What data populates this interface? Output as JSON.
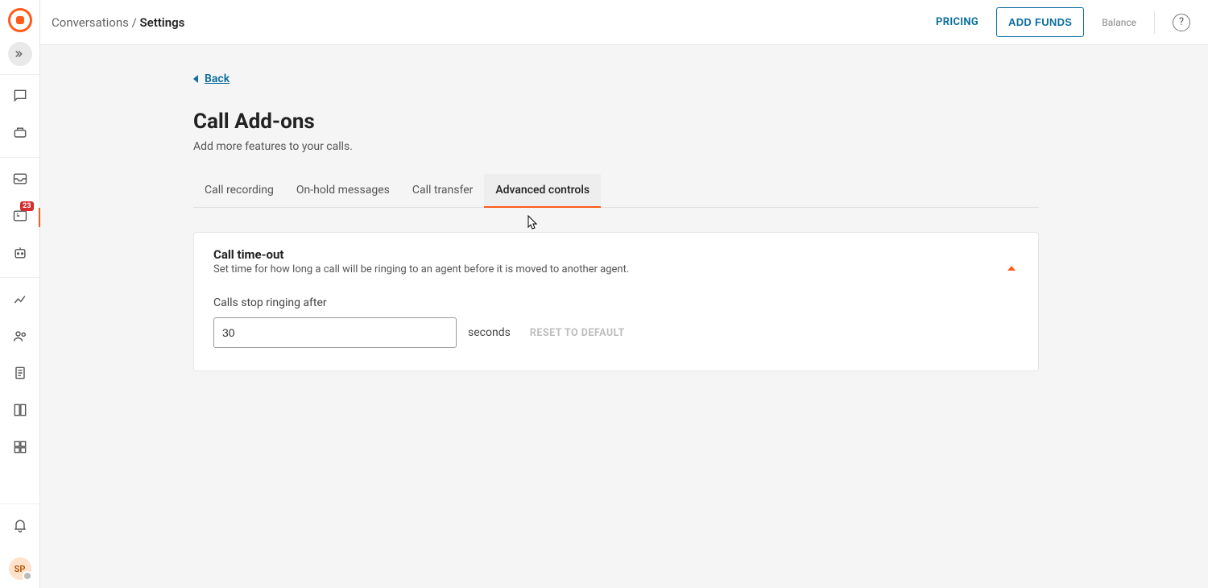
{
  "sidebar": {
    "badge_count": "23",
    "avatar_initials": "SP"
  },
  "topbar": {
    "crumb_root": "Conversations",
    "crumb_sep": " / ",
    "crumb_leaf": "Settings",
    "pricing": "PRICING",
    "add_funds": "ADD FUNDS",
    "balance_label": "Balance",
    "help_char": "?"
  },
  "page": {
    "back_label": "Back",
    "title": "Call Add-ons",
    "subtitle": "Add more features to your calls."
  },
  "tabs": [
    {
      "label": "Call recording",
      "active": false
    },
    {
      "label": "On-hold messages",
      "active": false
    },
    {
      "label": "Call transfer",
      "active": false
    },
    {
      "label": "Advanced controls",
      "active": true
    }
  ],
  "timeout_card": {
    "title": "Call time-out",
    "description": "Set time for how long a call will be ringing to an agent before it is moved to another agent.",
    "field_label": "Calls stop ringing after",
    "value": "30",
    "unit": "seconds",
    "reset_label": "RESET TO DEFAULT"
  }
}
